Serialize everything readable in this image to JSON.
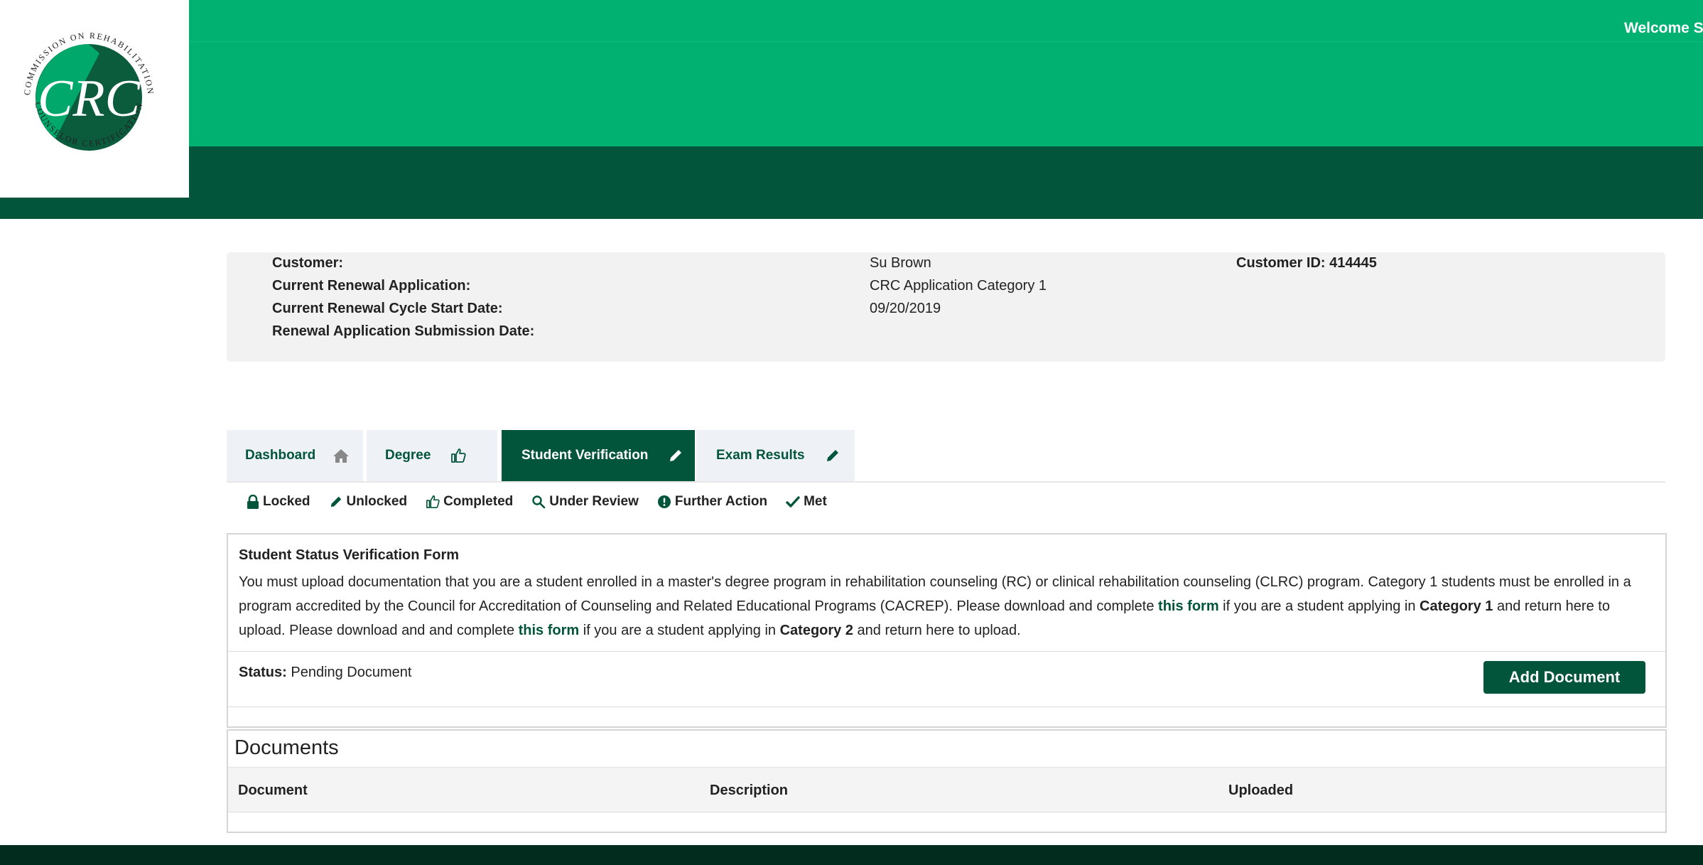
{
  "header": {
    "welcome_text": "Welcome Su",
    "logo": {
      "ring_text": "COMMISSION ON REHABILITATION",
      "ring_text_bottom": "COUNSELOR CERTIFICATION",
      "mark": "CRC"
    }
  },
  "customer_info": {
    "labels": [
      "Customer:",
      "Current Renewal Application:",
      "Current Renewal Cycle Start Date:",
      "Renewal Application Submission Date:"
    ],
    "values": [
      "Su Brown",
      "CRC Application Category 1",
      "09/20/2019",
      ""
    ],
    "customer_id": "Customer ID: 414445"
  },
  "tabs": [
    {
      "label": "Dashboard",
      "icon": "home-icon",
      "active": false
    },
    {
      "label": "Degree",
      "icon": "thumbs-up-icon",
      "active": false
    },
    {
      "label": "Student Verification",
      "icon": "pencil-icon",
      "active": true
    },
    {
      "label": "Exam Results",
      "icon": "pencil-icon",
      "active": false
    }
  ],
  "legend": [
    {
      "label": "Locked",
      "icon": "lock-icon"
    },
    {
      "label": "Unlocked",
      "icon": "pencil-icon"
    },
    {
      "label": "Completed",
      "icon": "thumbs-up-icon"
    },
    {
      "label": "Under Review",
      "icon": "search-icon"
    },
    {
      "label": "Further Action",
      "icon": "exclamation-circle-icon"
    },
    {
      "label": "Met",
      "icon": "check-icon"
    }
  ],
  "verification": {
    "title": "Student Status Verification Form",
    "body_part1": "You must upload documentation that you are a student enrolled in a master's degree program in rehabilitation counseling (RC) or clinical rehabilitation counseling (CLRC) program. Category 1 students must be enrolled in a program accredited by the Council for Accreditation of Counseling and Related Educational Programs (CACREP). Please download and complete ",
    "link1": "this form",
    "body_part2": " if you are a student applying in ",
    "category1": "Category 1",
    "body_part3": " and return here to upload. Please download and  and complete ",
    "link2": "this form",
    "body_part4": " if you are a student applying in ",
    "category2": "Category 2",
    "body_part5": " and return here to upload.",
    "status_label": "Status:",
    "status_value": " Pending Document",
    "add_button": "Add Document"
  },
  "documents": {
    "title": "Documents",
    "columns": [
      "Document",
      "Description",
      "Uploaded"
    ]
  },
  "colors": {
    "brand_green": "#00b172",
    "dark_green": "#02553a",
    "footer": "#022c1e"
  }
}
